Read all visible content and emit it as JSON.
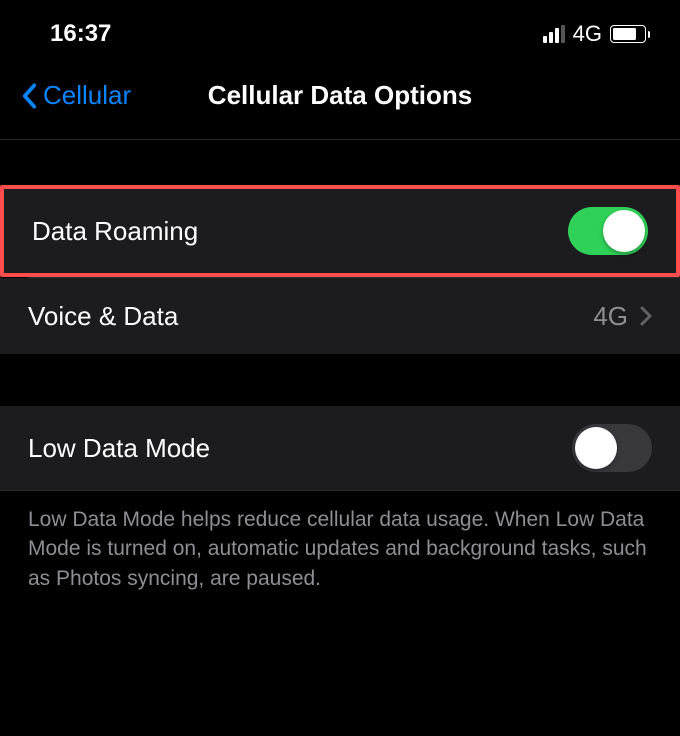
{
  "statusBar": {
    "time": "16:37",
    "networkLabel": "4G",
    "signalStrength": 3,
    "batteryPercent": 78
  },
  "nav": {
    "backLabel": "Cellular",
    "title": "Cellular Data Options"
  },
  "rows": {
    "dataRoaming": {
      "label": "Data Roaming",
      "toggled": true,
      "highlighted": true
    },
    "voiceData": {
      "label": "Voice & Data",
      "value": "4G"
    },
    "lowDataMode": {
      "label": "Low Data Mode",
      "toggled": false
    }
  },
  "footer": {
    "lowDataModeHelp": "Low Data Mode helps reduce cellular data usage. When Low Data Mode is turned on, automatic updates and background tasks, such as Photos syncing, are paused."
  },
  "colors": {
    "accent": "#0a84ff",
    "toggleOn": "#30d158",
    "highlight": "#ff4c4c"
  }
}
